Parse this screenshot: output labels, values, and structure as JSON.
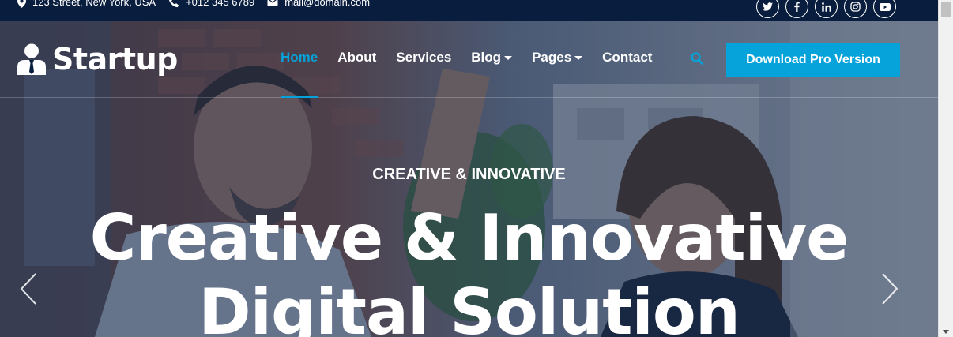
{
  "topbar": {
    "address": "123 Street, New York, USA",
    "phone": "+012 345 6789",
    "email": "mail@domain.com",
    "social": [
      {
        "name": "twitter-icon",
        "glyph": "🐦"
      },
      {
        "name": "facebook-icon",
        "glyph": "f"
      },
      {
        "name": "linkedin-icon",
        "glyph": "in"
      },
      {
        "name": "instagram-icon",
        "glyph": "◎"
      },
      {
        "name": "youtube-icon",
        "glyph": "▶"
      }
    ]
  },
  "brand": {
    "name": "Startup",
    "icon": "user-tie-icon"
  },
  "nav": {
    "items": [
      {
        "label": "Home",
        "active": true,
        "dropdown": false
      },
      {
        "label": "About",
        "active": false,
        "dropdown": false
      },
      {
        "label": "Services",
        "active": false,
        "dropdown": false
      },
      {
        "label": "Blog",
        "active": false,
        "dropdown": true
      },
      {
        "label": "Pages",
        "active": false,
        "dropdown": true
      },
      {
        "label": "Contact",
        "active": false,
        "dropdown": false
      }
    ],
    "search_icon": "search-icon",
    "cta_label": "Download Pro Version"
  },
  "hero": {
    "subtitle": "CREATIVE & INNOVATIVE",
    "title_line1": "Creative & Innovative",
    "title_line2": "Digital Solution"
  },
  "colors": {
    "primary": "#06a3da",
    "dark": "#091e3e",
    "white": "#ffffff"
  }
}
